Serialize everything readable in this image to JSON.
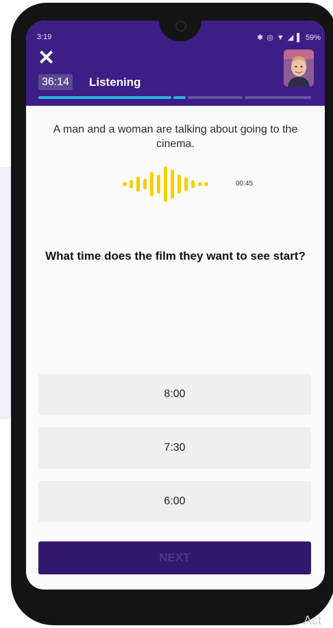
{
  "status_bar": {
    "time": "3:19",
    "battery": "59%",
    "icons": [
      "bluetooth-icon",
      "vibrate-icon",
      "wifi-icon",
      "signal-icon",
      "battery-icon"
    ]
  },
  "header": {
    "timer": "36:14",
    "title": "Listening",
    "close_icon": "close-icon"
  },
  "progress": {
    "completed_fraction": 0.54,
    "segments": 4
  },
  "prompt": {
    "text": "A man and a woman are talking about going to the cinema."
  },
  "audio": {
    "duration": "00:45",
    "waveform_color": "#f5d000"
  },
  "question": {
    "text": "What time does the film they want to see start?"
  },
  "options": [
    "8:00",
    "7:30",
    "6:00"
  ],
  "next_button": {
    "label": "NEXT"
  },
  "colors": {
    "header": "#3d1e87",
    "progress_active": "#29b6e8",
    "progress_inactive": "#6a55a6",
    "next_button": "#32176e"
  },
  "watermark": "Act"
}
